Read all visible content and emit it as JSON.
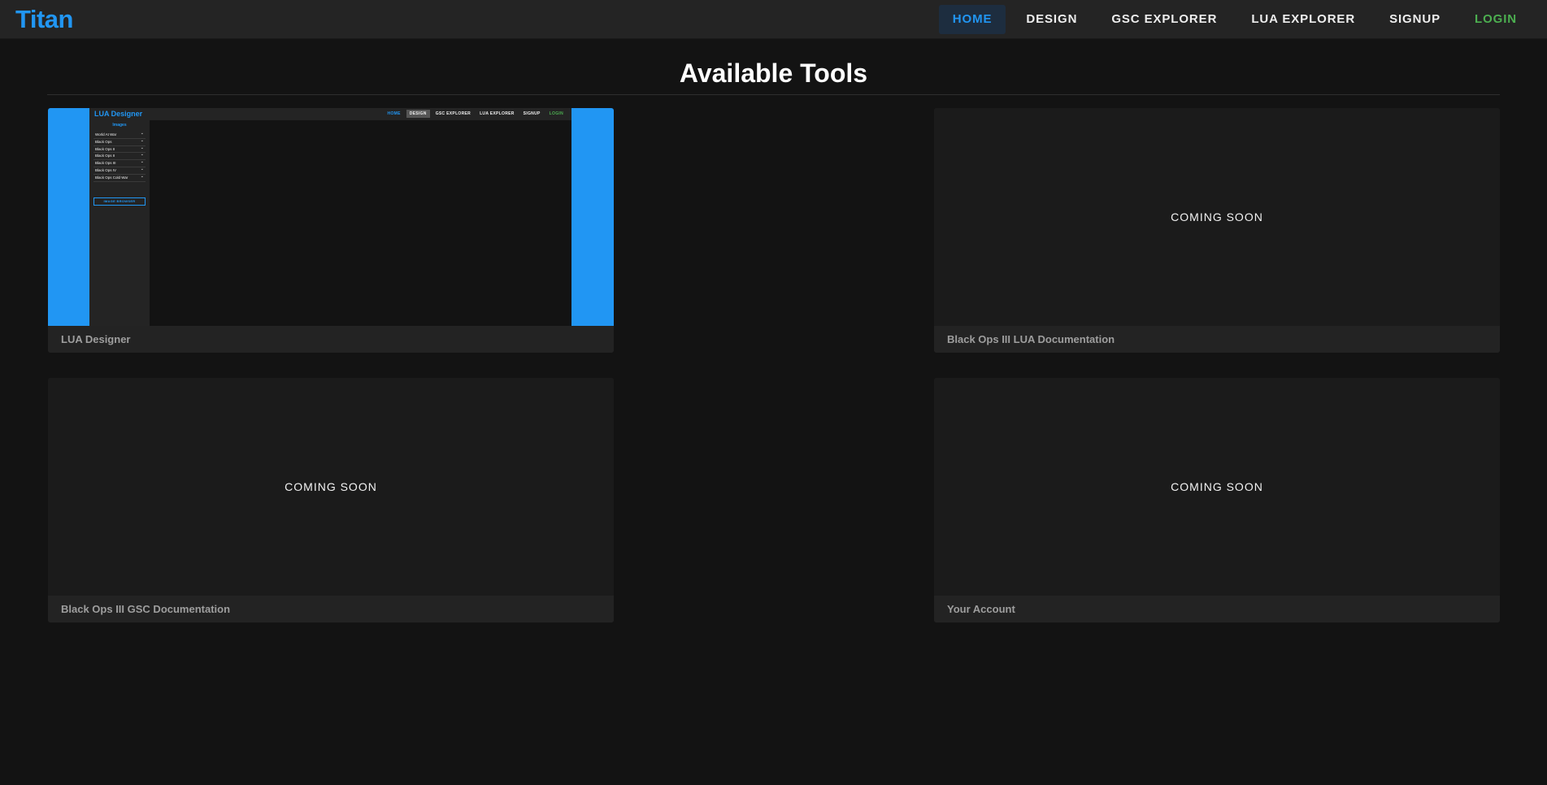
{
  "header": {
    "brand": "Titan",
    "nav": [
      {
        "label": "HOME",
        "active": true
      },
      {
        "label": "DESIGN"
      },
      {
        "label": "GSC EXPLORER"
      },
      {
        "label": "LUA EXPLORER"
      },
      {
        "label": "SIGNUP"
      },
      {
        "label": "LOGIN"
      }
    ]
  },
  "main": {
    "title": "Available Tools",
    "cards": [
      {
        "title": "LUA Designer",
        "has_preview": true
      },
      {
        "title": "Black Ops III LUA Documentation",
        "placeholder": "COMING SOON"
      },
      {
        "title": "Black Ops III GSC Documentation",
        "placeholder": "COMING SOON"
      },
      {
        "title": "Your Account",
        "placeholder": "COMING SOON"
      }
    ]
  },
  "preview": {
    "brand": "LUA Designer",
    "nav": [
      "HOME",
      "DESIGN",
      "GSC EXPLORER",
      "LUA EXPLORER",
      "SIGNUP",
      "LOGIN"
    ],
    "sidebar_title": "Images",
    "games": [
      "World At War",
      "Black Ops",
      "Black Ops II",
      "Black Ops II",
      "Black Ops III",
      "Black Ops IV",
      "Black Ops Cold War"
    ],
    "button": "IMAGE BROWSER"
  },
  "colors": {
    "accent": "#2196f3",
    "login": "#4caf50",
    "background": "#131313",
    "surface": "#242424"
  }
}
